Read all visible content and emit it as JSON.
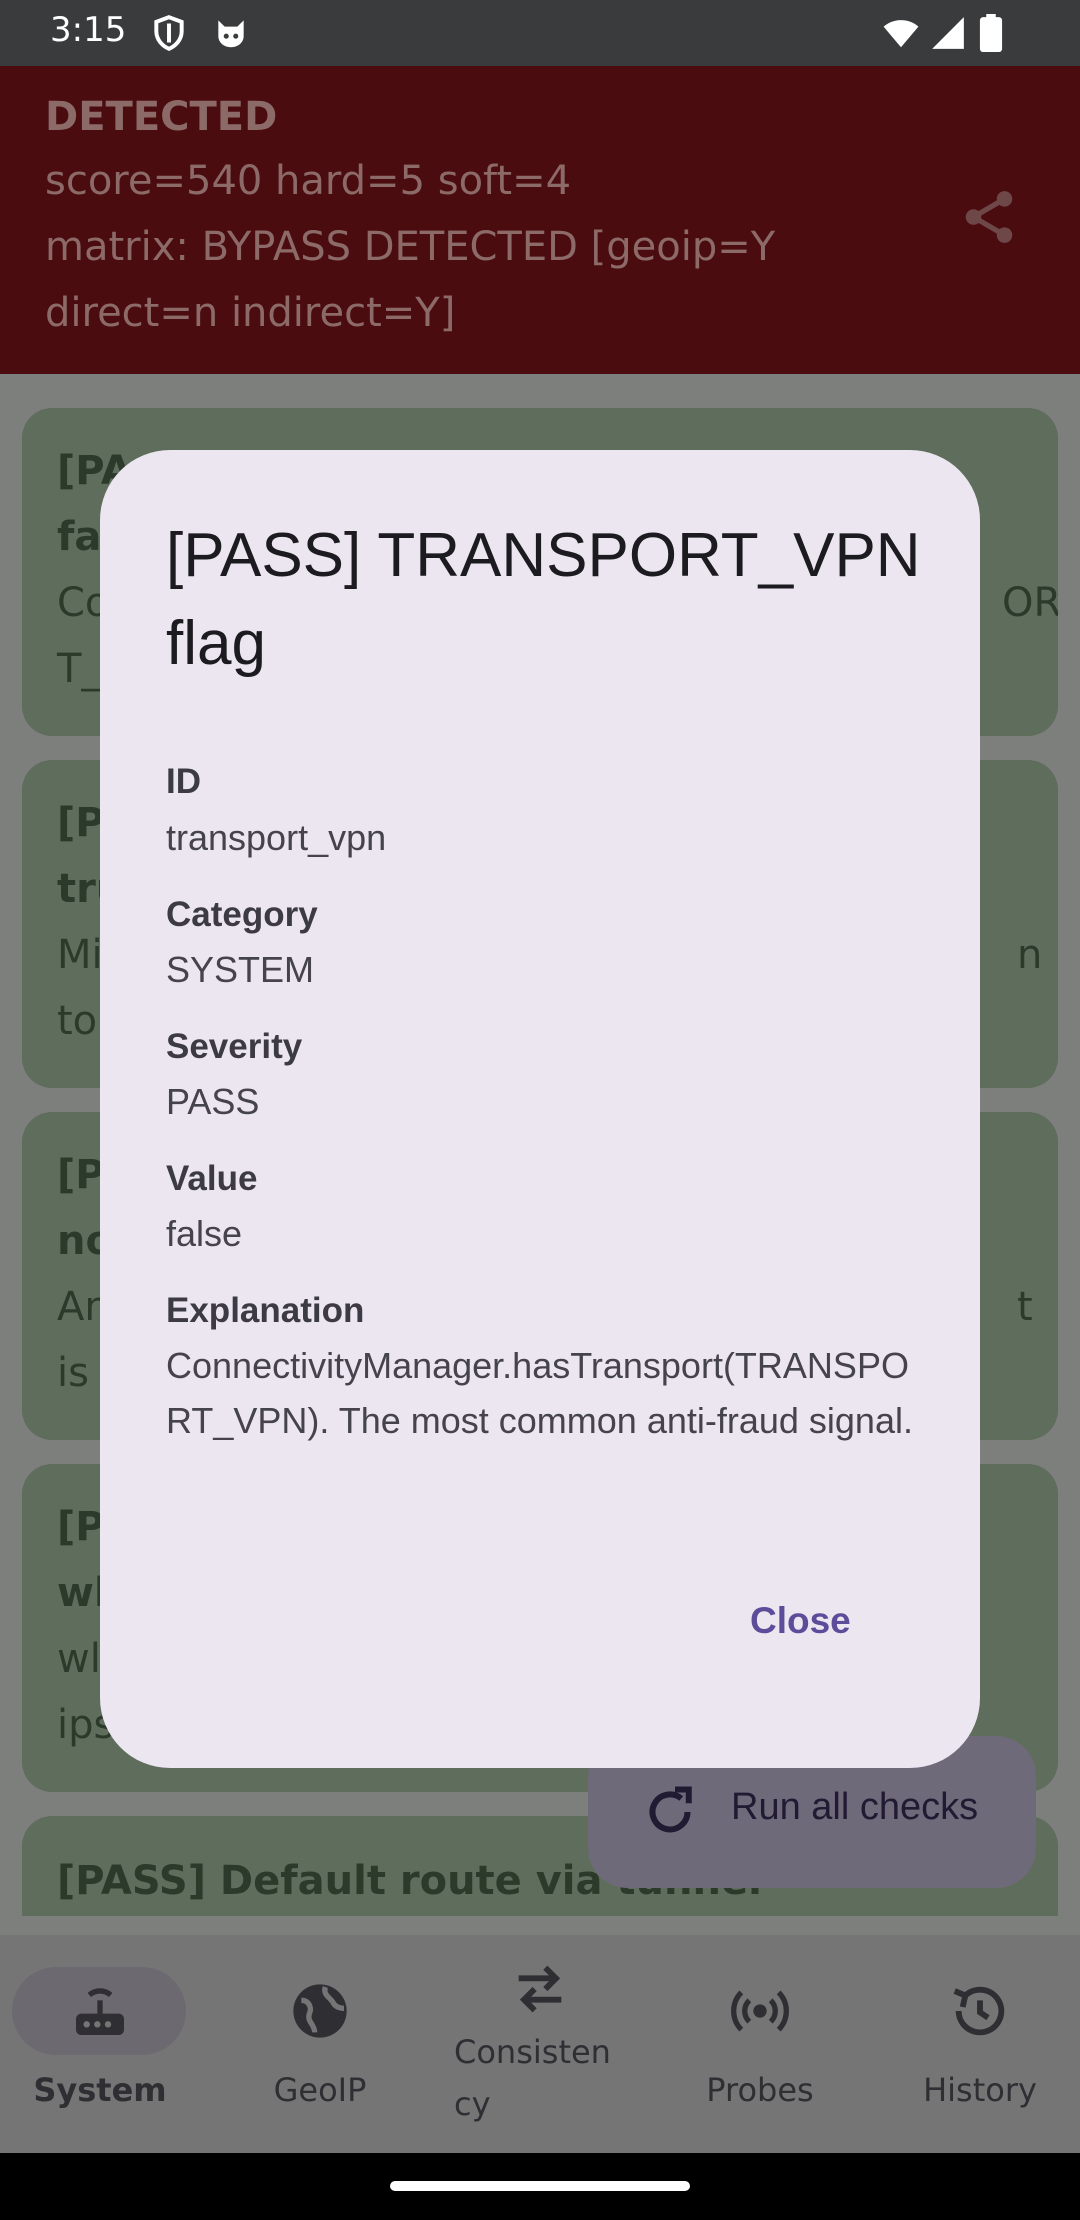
{
  "status_bar": {
    "time": "3:15"
  },
  "header": {
    "status_title": "DETECTED",
    "score_line": "score=540  hard=5  soft=4",
    "matrix_line1": "matrix: BYPASS DETECTED  [geoip=Y",
    "matrix_line2": "direct=n indirect=Y]"
  },
  "background_cards": [
    {
      "line1": "[PA",
      "line2": "fa",
      "line3": "Co",
      "line3_tail": "OR",
      "line4": "T_"
    },
    {
      "line1": "[PA",
      "line2": "tru",
      "line3": "Mi",
      "line3_tail": "n",
      "line4": "to"
    },
    {
      "line1": "[PA",
      "line2": "no",
      "line3": "An",
      "line3_tail": "t",
      "line4": "is"
    },
    {
      "line1": "[PA",
      "line2": "wl",
      "line3": "wl",
      "line4": "ips"
    },
    {
      "line1": "[PASS] Default route via tunnel"
    }
  ],
  "fab": {
    "label": "Run all checks"
  },
  "bottom_nav": {
    "items": [
      {
        "label": "System"
      },
      {
        "label": "GeoIP"
      },
      {
        "label_line1": "Consisten",
        "label_line2": "cy"
      },
      {
        "label": "Probes"
      },
      {
        "label": "History"
      }
    ]
  },
  "dialog": {
    "title": "[PASS] TRANSPORT_VPN flag",
    "fields": [
      {
        "label": "ID",
        "value": "transport_vpn"
      },
      {
        "label": "Category",
        "value": "SYSTEM"
      },
      {
        "label": "Severity",
        "value": "PASS"
      },
      {
        "label": "Value",
        "value": "false"
      },
      {
        "label": "Explanation",
        "value": "ConnectivityManager.hasTransport(TRANSPORT_VPN). The most common anti-fraud signal."
      }
    ],
    "close_label": "Close"
  }
}
